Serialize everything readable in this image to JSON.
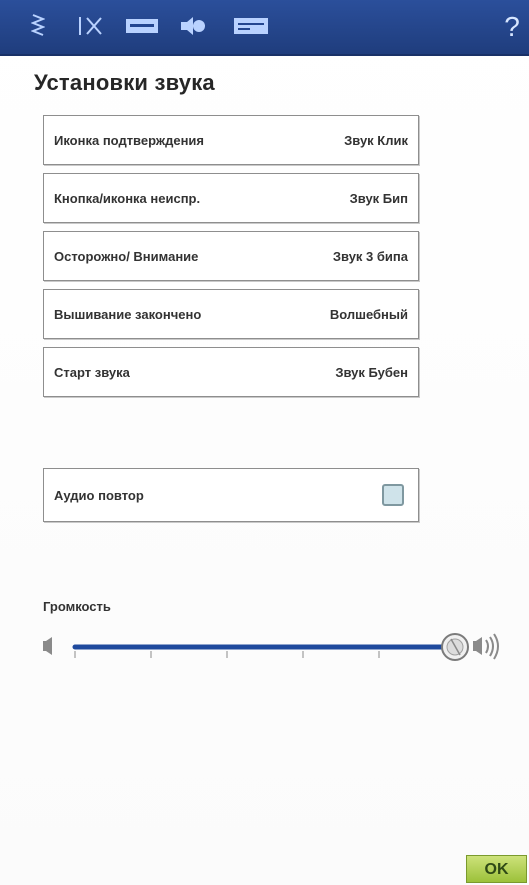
{
  "toolbar": {
    "icons": [
      {
        "name": "stitch-settings-icon"
      },
      {
        "name": "tension-settings-icon"
      },
      {
        "name": "embroidery-hoop-icon"
      },
      {
        "name": "sound-icon"
      },
      {
        "name": "machine-icon"
      }
    ],
    "help_label": "?"
  },
  "title": "Установки звука",
  "sound_settings": [
    {
      "label": "Иконка подтверждения",
      "value": "Звук Клик"
    },
    {
      "label": "Кнопка/иконка неиспр.",
      "value": "Звук Бип"
    },
    {
      "label": "Осторожно/ Внимание",
      "value": "Звук 3 бипа"
    },
    {
      "label": "Вышивание закончено",
      "value": "Волшебный"
    },
    {
      "label": "Старт звука",
      "value": "Звук Бубен"
    }
  ],
  "audio_repeat": {
    "label": "Аудио повтор",
    "checked": false
  },
  "volume": {
    "label": "Громкость",
    "level": 1.0,
    "ticks": 5
  },
  "ok_label": "OK",
  "colors": {
    "toolbar": "#244690",
    "slider_track": "#1f4a9d",
    "ok_button": "#b5d45a",
    "checkbox": "#cfe3ea"
  }
}
